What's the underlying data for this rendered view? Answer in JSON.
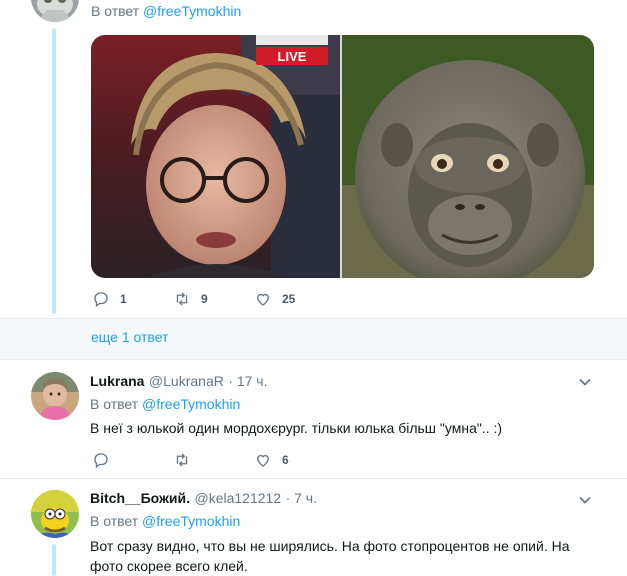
{
  "top_tweet": {
    "reply_prefix": "В ответ",
    "reply_handle": "@freeTymokhin",
    "live_badge": "LIVE",
    "actions": {
      "reply_count": "1",
      "retweet_count": "9",
      "like_count": "25"
    }
  },
  "more_replies": "еще 1 ответ",
  "tweets": [
    {
      "name": "Lukrana",
      "screen_name": "@LukranaR",
      "time": "· 17 ч.",
      "reply_prefix": "В ответ",
      "reply_handle": "@freeTymokhin",
      "text": "В неї з юлькой один мордохєрург. тільки  юлька більш \"умна\".. :)",
      "actions": {
        "reply_count": "",
        "retweet_count": "",
        "like_count": "6"
      }
    },
    {
      "name": "Bitch__Божий.",
      "screen_name": "@kela121212",
      "time": "· 7 ч.",
      "reply_prefix": "В ответ",
      "reply_handle": "@freeTymokhin",
      "text_line1": "Вот сразу видно, что вы не ширялись. На фото стопроцентов не опий. На",
      "text_line2": "фото скорее всего клей."
    }
  ],
  "colors": {
    "link": "#1da1f2",
    "muted": "#657786",
    "thread": "#c4e6fb"
  }
}
